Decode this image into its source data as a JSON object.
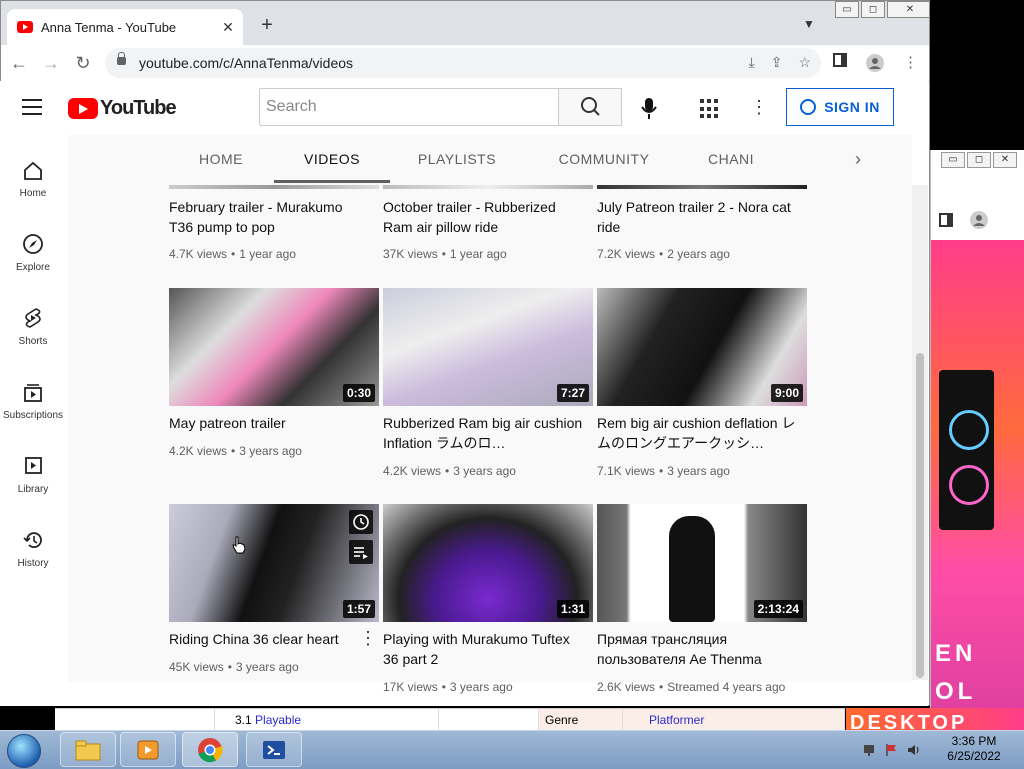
{
  "browser": {
    "tab_title": "Anna Tenma - YouTube",
    "tab_close": "✕",
    "new_tab": "+",
    "url": "youtube.com/c/AnnaTenma/videos"
  },
  "header": {
    "logo_text": "YouTube",
    "search_placeholder": "Search",
    "signin_label": "SIGN IN"
  },
  "sidebar": {
    "items": [
      {
        "label": "Home",
        "icon": "home-icon"
      },
      {
        "label": "Explore",
        "icon": "compass-icon"
      },
      {
        "label": "Shorts",
        "icon": "shorts-icon"
      },
      {
        "label": "Subscriptions",
        "icon": "subscriptions-icon"
      },
      {
        "label": "Library",
        "icon": "library-icon"
      },
      {
        "label": "History",
        "icon": "history-icon"
      }
    ]
  },
  "channel_tabs": [
    {
      "label": "HOME"
    },
    {
      "label": "VIDEOS"
    },
    {
      "label": "PLAYLISTS"
    },
    {
      "label": "COMMUNITY"
    },
    {
      "label": "CHANI"
    }
  ],
  "videos": [
    {
      "title": "February trailer - Murakumo T36 pump to pop",
      "views": "4.7K views",
      "age": "1 year ago",
      "duration": ""
    },
    {
      "title": "October trailer - Rubberized Ram air pillow ride",
      "views": "37K views",
      "age": "1 year ago",
      "duration": ""
    },
    {
      "title": "July Patreon trailer 2 - Nora cat ride",
      "views": "7.2K views",
      "age": "2 years ago",
      "duration": ""
    },
    {
      "title": "May patreon trailer",
      "views": "4.2K views",
      "age": "3 years ago",
      "duration": "0:30"
    },
    {
      "title": "Rubberized Ram big air cushion Inflation ラムのロ…",
      "views": "4.2K views",
      "age": "3 years ago",
      "duration": "7:27"
    },
    {
      "title": "Rem big air cushion deflation レムのロングエアークッシ…",
      "views": "7.1K views",
      "age": "3 years ago",
      "duration": "9:00"
    },
    {
      "title": "Riding China 36 clear heart",
      "views": "45K views",
      "age": "3 years ago",
      "duration": "1:57"
    },
    {
      "title": "Playing with Murakumo Tuftex 36 part 2",
      "views": "17K views",
      "age": "3 years ago",
      "duration": "1:31"
    },
    {
      "title": "Прямая трансляция пользователя Ae Thenma",
      "views": "2.6K views",
      "age": "Streamed 4 years ago",
      "duration": "2:13:24"
    }
  ],
  "background_window": {
    "row_num": "3.1",
    "row_link": "Playable",
    "genre_label": "Genre",
    "genre_value": "Platformer"
  },
  "taskbar": {
    "time": "3:36 PM",
    "date": "6/25/2022"
  },
  "colors": {
    "youtube_red": "#ff0000",
    "link_blue": "#065fd4"
  }
}
